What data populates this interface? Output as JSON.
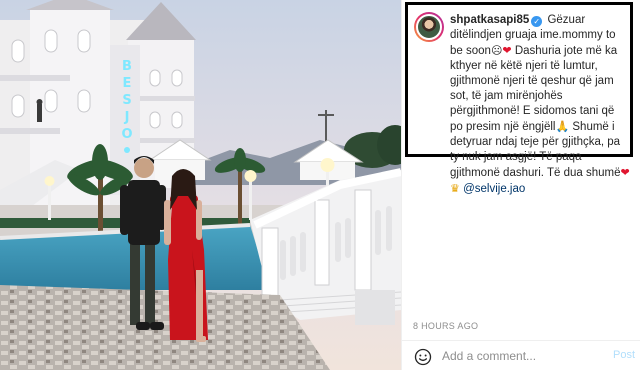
{
  "post": {
    "sign_letters": [
      "B",
      "E",
      "S",
      "J",
      "O"
    ]
  },
  "caption": {
    "username": "shpatkasapi85",
    "verified_icon": "verified-badge-icon",
    "line1": "Gëzuar ditëlindjen gruaja ime.mommy to be soon",
    "line2": "Dashuria jote më ka kthyer në këtë njeri të lumtur, gjithmonë njeri të qeshur që jam sot, të jam mirënjohës përgjithmonë! E sidomos tani që po presim një ëngjëll",
    "line3": "Shumë i detyruar ndaj teje për gjithçka, pa ty nuk jam asgjë! Të paqa gjithmonë dashuri. Të dua shumë",
    "mention": "@selvije.jao",
    "emoji_1": "☹",
    "emoji_2": "❤",
    "emoji_3": "🙏",
    "emoji_4": "❤",
    "emoji_5": "♛"
  },
  "timestamp": "8 HOURS AGO",
  "comment": {
    "placeholder": "Add a comment...",
    "post_label": "Post",
    "emoji_icon": "smiley-icon"
  },
  "colors": {
    "verified": "#3897f0",
    "heart": "#e0152f",
    "post_disabled": "#b2dffc",
    "dress": "#c9141c"
  }
}
